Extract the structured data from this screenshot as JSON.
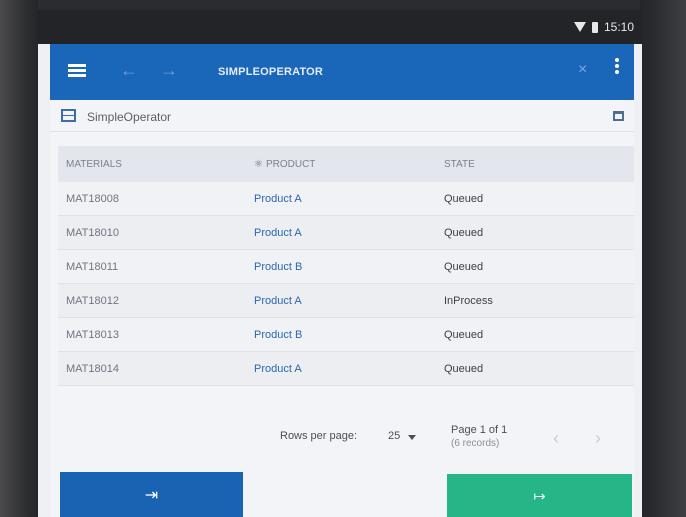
{
  "statusbar": {
    "time": "15:10"
  },
  "appbar": {
    "title": "SIMPLEOPERATOR"
  },
  "panel": {
    "title": "SimpleOperator"
  },
  "table": {
    "headers": [
      "MATERIALS",
      "PRODUCT",
      "STATE"
    ],
    "rows": [
      [
        "MAT18008",
        "Product A",
        "Queued"
      ],
      [
        "MAT18010",
        "Product A",
        "Queued"
      ],
      [
        "MAT18011",
        "Product B",
        "Queued"
      ],
      [
        "MAT18012",
        "Product A",
        "InProcess"
      ],
      [
        "MAT18013",
        "Product B",
        "Queued"
      ],
      [
        "MAT18014",
        "Product A",
        "Queued"
      ]
    ]
  },
  "pagination": {
    "rows_label": "Rows per page:",
    "rows_value": "25",
    "page": "Page 1 of 1",
    "records": "(6 records)"
  },
  "colors": {
    "accent": "#1a66b8",
    "success": "#25b586"
  }
}
